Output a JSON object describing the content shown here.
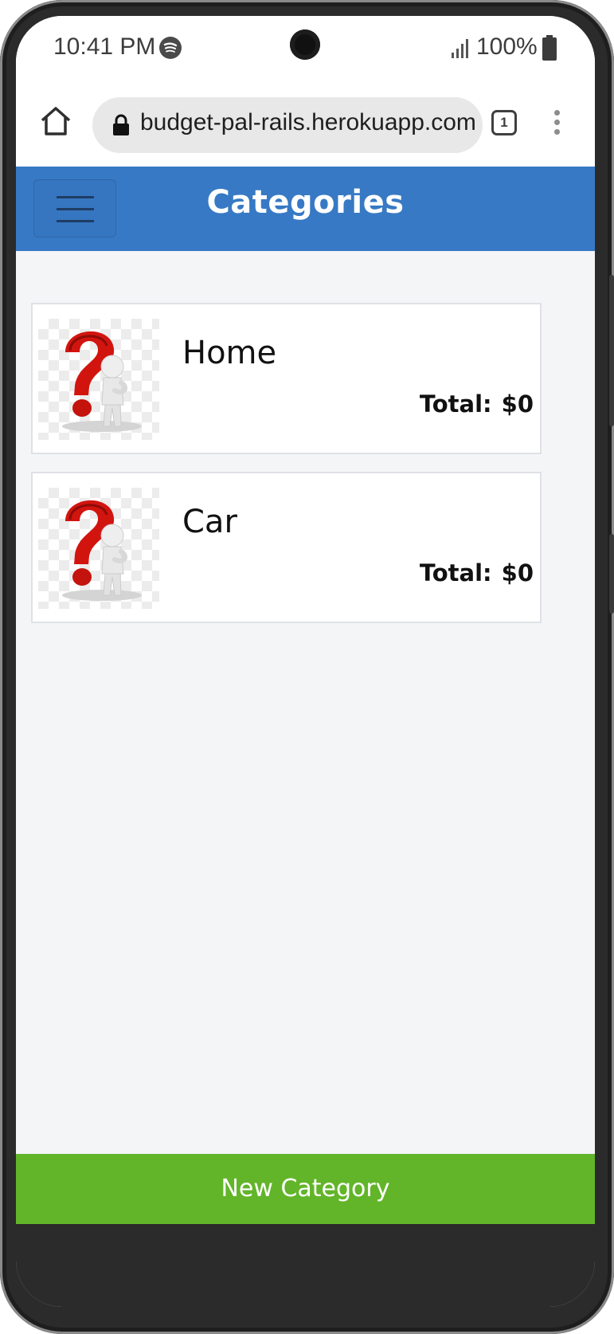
{
  "status_bar": {
    "time": "10:41 PM",
    "battery": "100%"
  },
  "browser": {
    "url": "budget-pal-rails.herokuapp.com",
    "tab_count": "1"
  },
  "header": {
    "title": "Categories"
  },
  "categories": [
    {
      "name": "Home",
      "total_label": "Total:",
      "total_value": "$0"
    },
    {
      "name": "Car",
      "total_label": "Total:",
      "total_value": "$0"
    }
  ],
  "footer": {
    "new_category_label": "New Category"
  },
  "icons": {
    "menu": "hamburger-icon",
    "home": "home-icon",
    "lock": "lock-icon",
    "thumbnail": "question-mark-person-image"
  },
  "colors": {
    "header": "#3779c4",
    "button": "#62b529",
    "background": "#f4f5f7"
  }
}
